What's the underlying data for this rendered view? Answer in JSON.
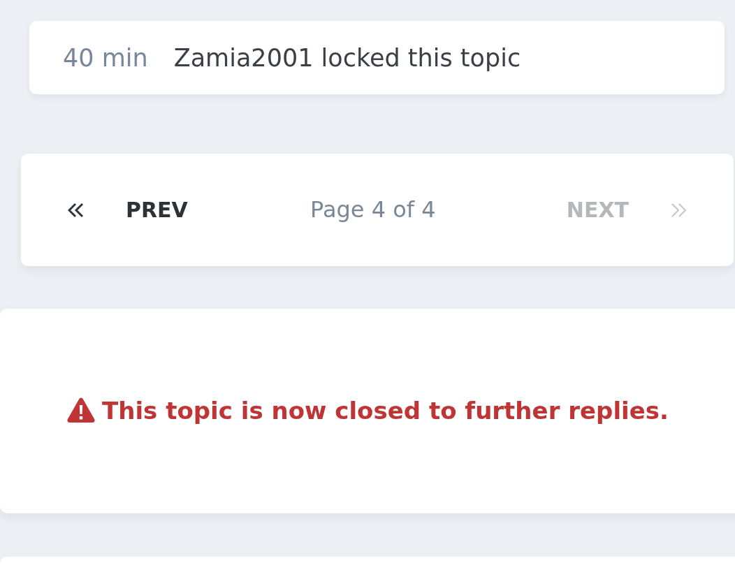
{
  "events": [
    {
      "time": "40 min",
      "text": "Zamia2001 locked this topic"
    }
  ],
  "pagination": {
    "prev": {
      "label": "PREV",
      "disabled": false
    },
    "page_label": "Page 4 of 4",
    "next": {
      "label": "NEXT",
      "disabled": true
    }
  },
  "closed_notice": {
    "kind": "warning",
    "text": "This topic is now closed to further replies."
  }
}
